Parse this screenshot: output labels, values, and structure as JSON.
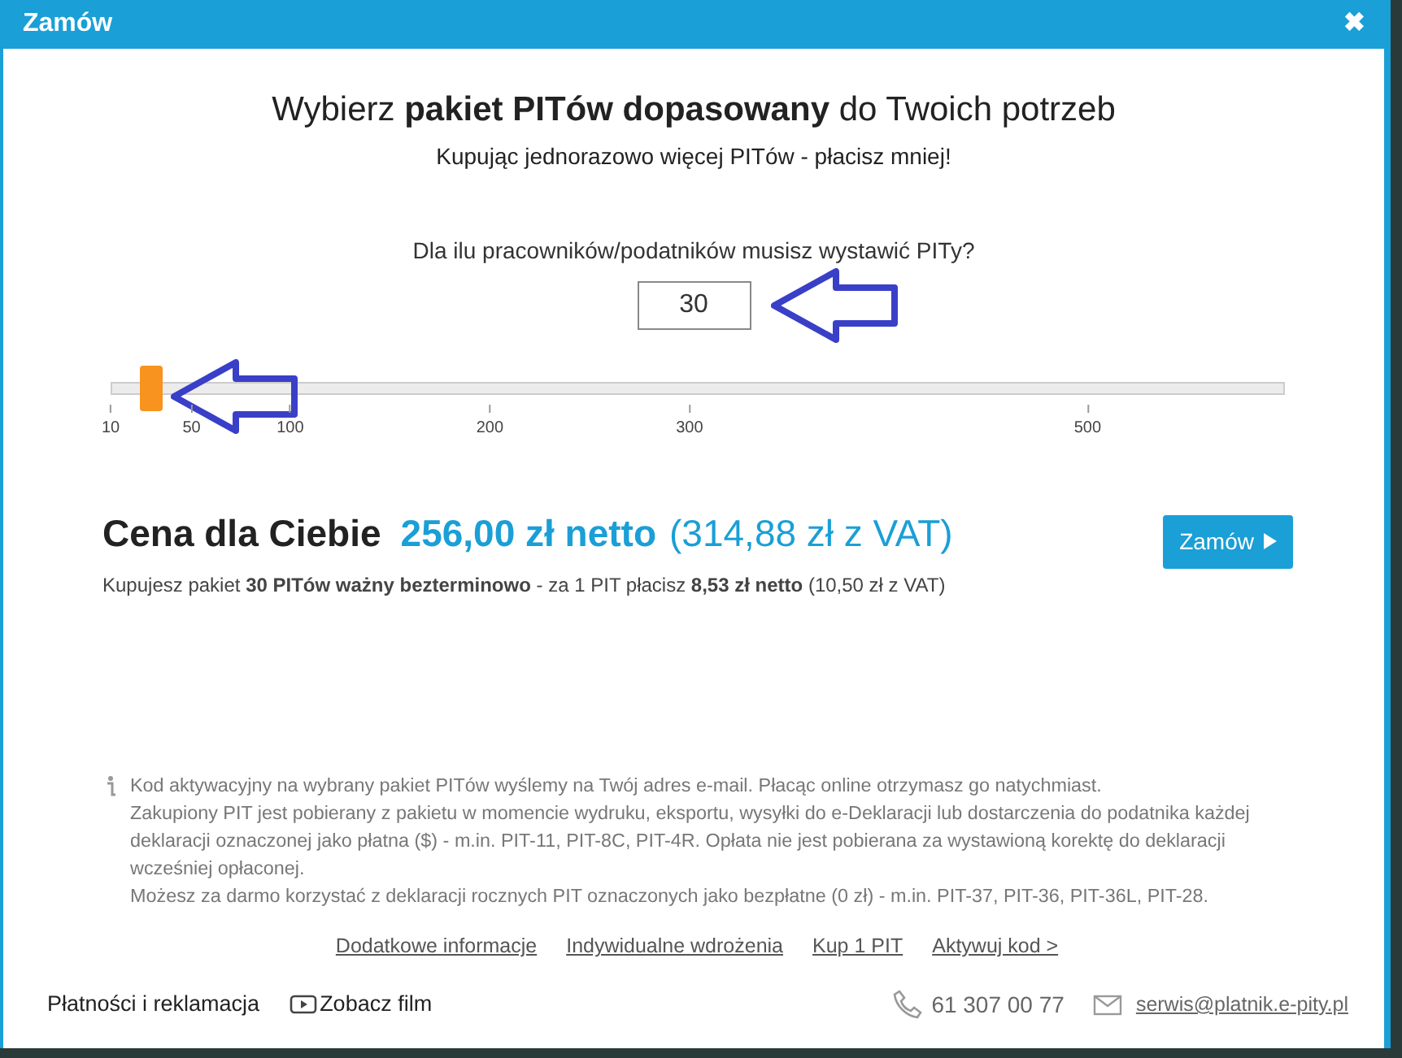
{
  "window": {
    "title": "Zamów",
    "close": "✖"
  },
  "heading": "Wybierz **pakiet PITów dopasowany** do Twoich potrzeb",
  "subheading": "Kupując jednorazowo więcej PITów - płacisz mniej!",
  "question": "Dla ilu pracowników/podatników musisz wystawić PITy?",
  "count_field": {
    "value": "30"
  },
  "slider": {
    "level": 0.035,
    "ticks": [
      "10",
      "50",
      "100",
      "200",
      "300",
      "500"
    ]
  },
  "price": {
    "label": "Cena dla Ciebie",
    "net": "256,00 zł netto",
    "gross": "(314,88 zł z VAT)",
    "details": "Kupujesz pakiet **30 PITów ważny bezterminowo** - za 1 PIT płacisz **8,53 zł netto** (10,50 zł z VAT)"
  },
  "order_button": "Zamów",
  "info": [
    "Kod aktywacyjny na wybrany pakiet PITów wyślemy na Twój adres e-mail. Płacąc online otrzymasz go natychmiast.",
    "Zakupiony PIT jest pobierany z pakietu w momencie wydruku, eksportu, wysyłki do e-Deklaracji lub dostarczenia do podatnika każdej deklaracji oznaczonej jako płatna ($) - m.in. PIT-11, PIT-8C, PIT-4R. Opłata nie jest pobierana za wystawioną korektę do deklaracji wcześniej opłaconej.",
    "Możesz za darmo korzystać z deklaracji rocznych PIT oznaczonych jako bezpłatne (0 zł) - m.in. PIT-37, PIT-36, PIT-36L, PIT-28."
  ],
  "links": [
    "Dodatkowe informacje",
    "Indywidualne wdrożenia",
    "Kup 1 PIT",
    "Aktywuj kod >"
  ],
  "footer": {
    "complaints": "Płatności i reklamacja",
    "video": "Zobacz film",
    "phone": "61 307 00 77",
    "email": "serwis@platnik.e-pity.pl"
  }
}
